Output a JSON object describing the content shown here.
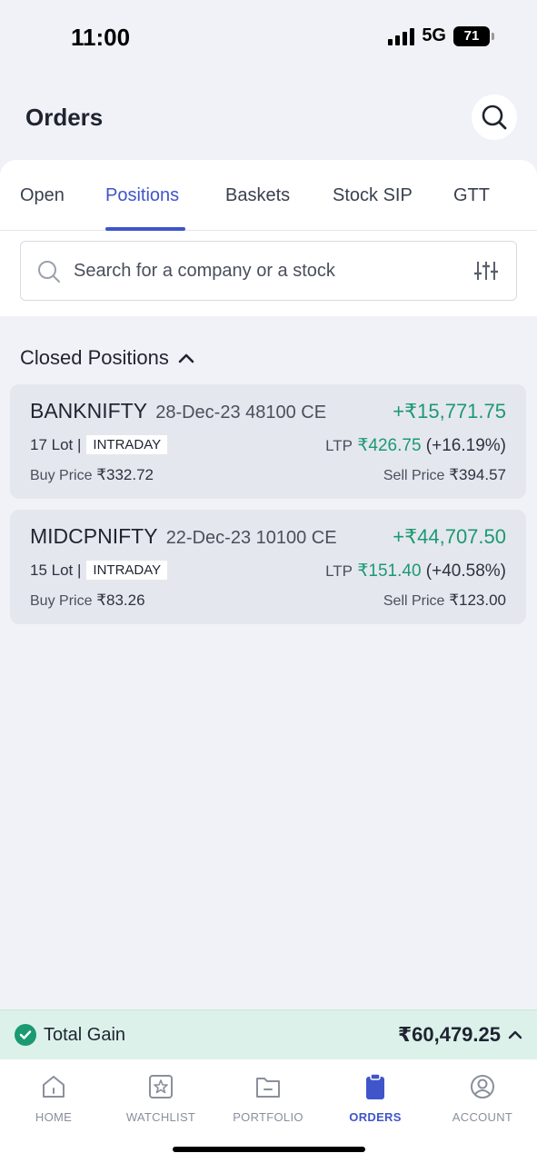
{
  "status_bar": {
    "time": "11:00",
    "network": "5G",
    "battery": "71"
  },
  "header": {
    "title": "Orders"
  },
  "tabs": [
    {
      "label": "Open",
      "active": false
    },
    {
      "label": "Positions",
      "active": true
    },
    {
      "label": "Baskets",
      "active": false
    },
    {
      "label": "Stock SIP",
      "active": false
    },
    {
      "label": "GTT",
      "active": false
    }
  ],
  "search": {
    "placeholder": "Search for a company or a stock"
  },
  "section": {
    "title": "Closed Positions"
  },
  "positions": [
    {
      "symbol": "BANKNIFTY",
      "contract": "28-Dec-23 48100 CE",
      "pnl": "+₹15,771.75",
      "lots": "17 Lot |",
      "product": "INTRADAY",
      "ltp_label": "LTP",
      "ltp": "₹426.75",
      "change": "(+16.19%)",
      "buy_label": "Buy Price",
      "buy_price": "₹332.72",
      "sell_label": "Sell Price",
      "sell_price": "₹394.57"
    },
    {
      "symbol": "MIDCPNIFTY",
      "contract": "22-Dec-23 10100 CE",
      "pnl": "+₹44,707.50",
      "lots": "15 Lot |",
      "product": "INTRADAY",
      "ltp_label": "LTP",
      "ltp": "₹151.40",
      "change": "(+40.58%)",
      "buy_label": "Buy Price",
      "buy_price": "₹83.26",
      "sell_label": "Sell Price",
      "sell_price": "₹123.00"
    }
  ],
  "total_gain": {
    "label": "Total Gain",
    "value": "₹60,479.25"
  },
  "bottom_nav": [
    {
      "label": "HOME",
      "icon": "home-icon",
      "active": false
    },
    {
      "label": "WATCHLIST",
      "icon": "watchlist-icon",
      "active": false
    },
    {
      "label": "PORTFOLIO",
      "icon": "portfolio-icon",
      "active": false
    },
    {
      "label": "ORDERS",
      "icon": "orders-icon",
      "active": true
    },
    {
      "label": "ACCOUNT",
      "icon": "account-icon",
      "active": false
    }
  ],
  "colors": {
    "accent": "#3f55c9",
    "gain": "#1b9a72"
  }
}
